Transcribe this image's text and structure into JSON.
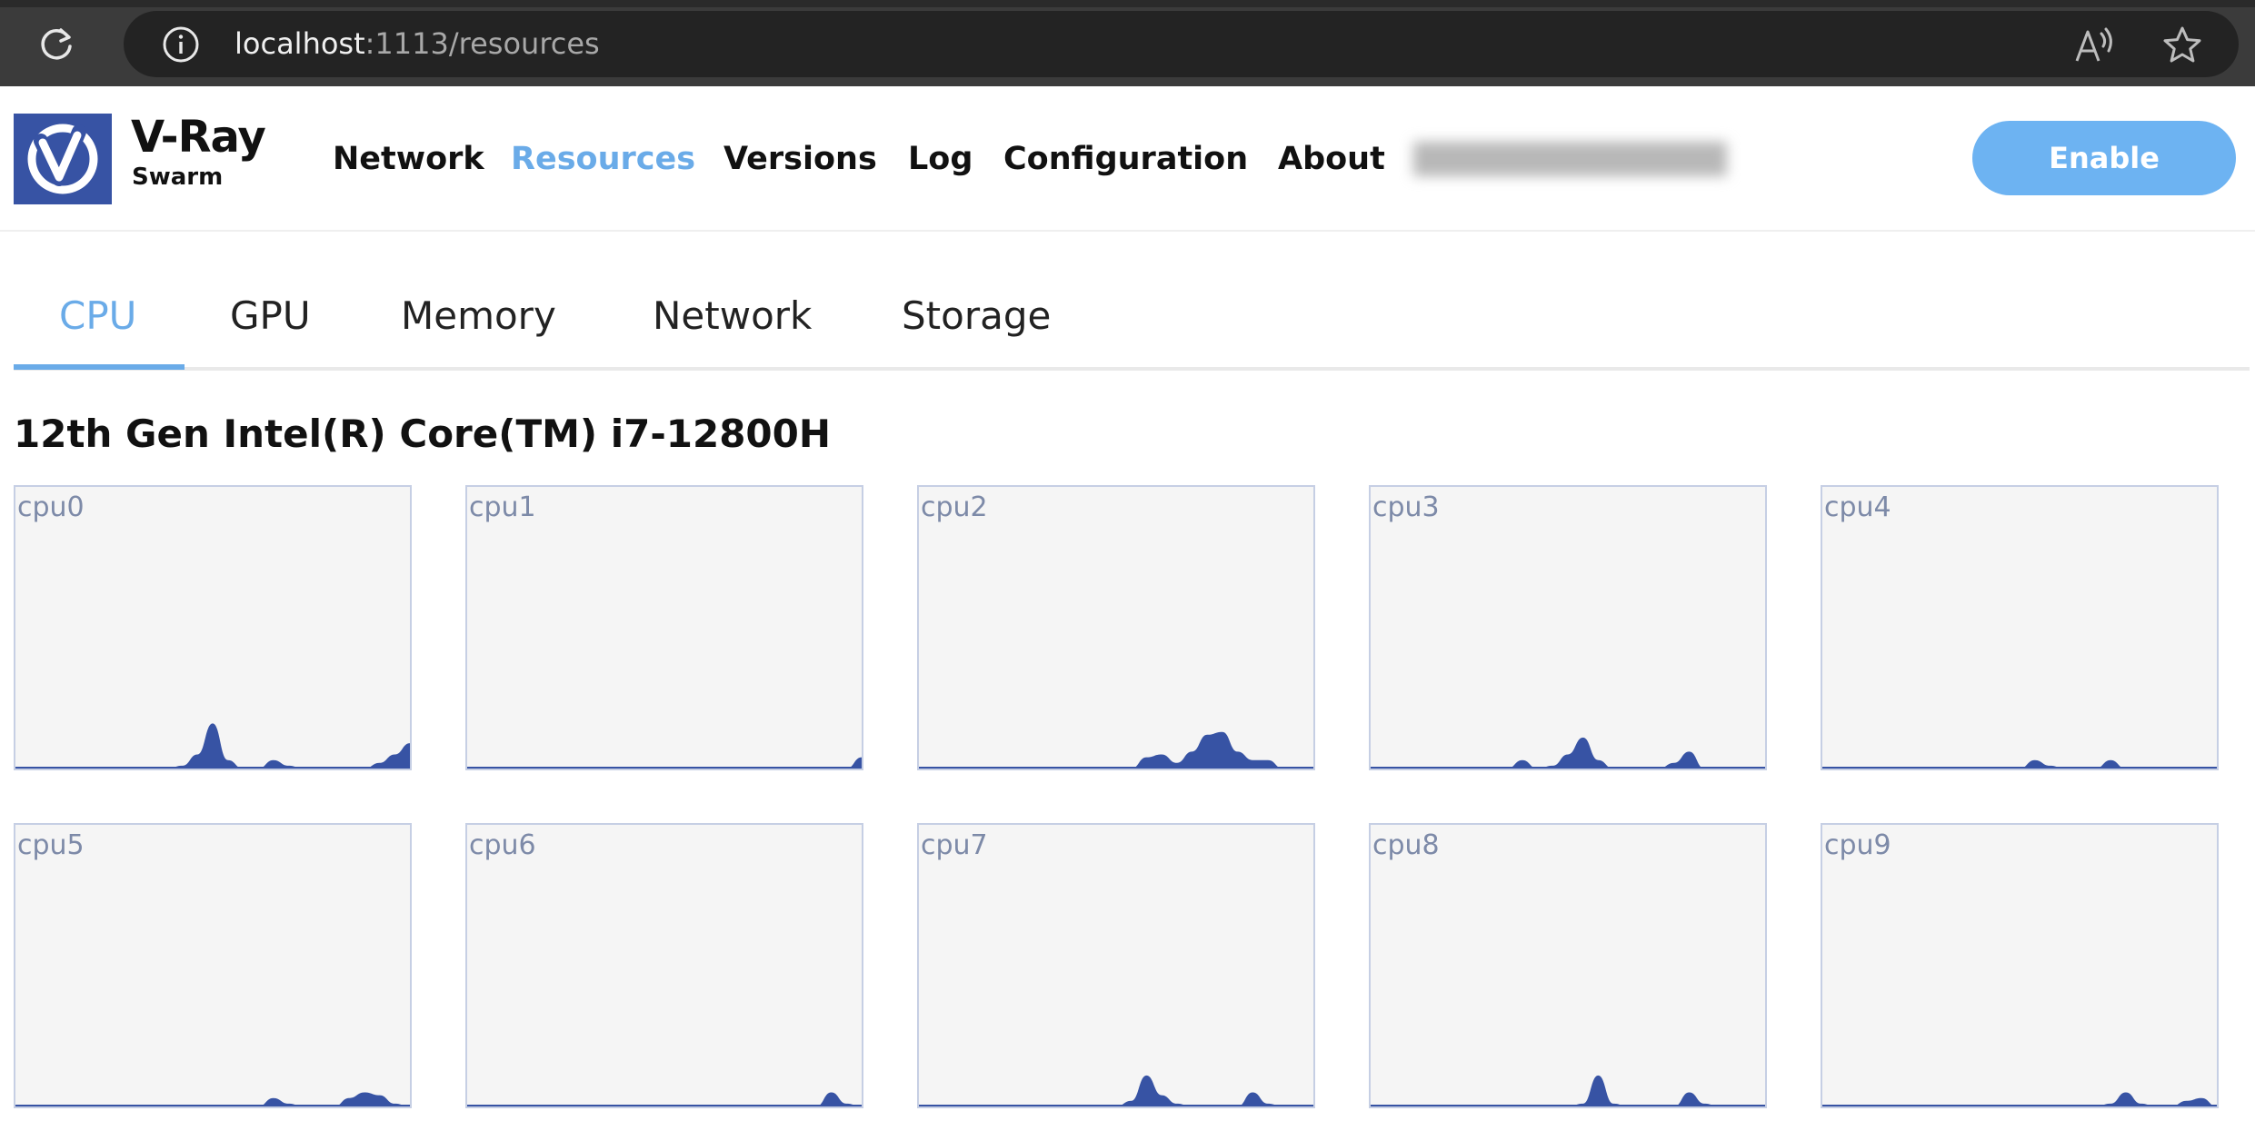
{
  "browser": {
    "url_host": "localhost",
    "url_rest": ":1113/resources",
    "icons": [
      "reload-icon",
      "info-icon",
      "read-aloud-icon",
      "favorite-star-icon"
    ]
  },
  "header": {
    "logo_title": "V-Ray",
    "logo_sub": "Swarm",
    "nav": [
      {
        "label": "Network",
        "active": false
      },
      {
        "label": "Resources",
        "active": true
      },
      {
        "label": "Versions",
        "active": false
      },
      {
        "label": "Log",
        "active": false
      },
      {
        "label": "Configuration",
        "active": false
      },
      {
        "label": "About",
        "active": false
      }
    ],
    "enable_label": "Enable",
    "accent_color": "#6db3f2",
    "brand_color": "#3753a4"
  },
  "tabs": [
    {
      "label": "CPU",
      "active": true
    },
    {
      "label": "GPU",
      "active": false
    },
    {
      "label": "Memory",
      "active": false
    },
    {
      "label": "Network",
      "active": false
    },
    {
      "label": "Storage",
      "active": false
    }
  ],
  "cpu": {
    "model": "12th Gen Intel(R) Core(TM) i7-12800H",
    "series_color": "#3753a4",
    "chart_data": [
      {
        "type": "area",
        "name": "cpu0",
        "ylim": [
          0,
          100
        ],
        "values": [
          0,
          0,
          0,
          0,
          0,
          0,
          0,
          0,
          0,
          0,
          0,
          1,
          5,
          16,
          3,
          0,
          0,
          3,
          1,
          0,
          0,
          0,
          0,
          0,
          2,
          5,
          9
        ]
      },
      {
        "type": "area",
        "name": "cpu1",
        "ylim": [
          0,
          100
        ],
        "values": [
          0,
          0,
          0,
          0,
          0,
          0,
          0,
          0,
          0,
          0,
          0,
          0,
          0,
          0,
          0,
          0,
          0,
          0,
          0,
          0,
          0,
          0,
          0,
          0,
          0,
          0,
          4
        ]
      },
      {
        "type": "area",
        "name": "cpu2",
        "ylim": [
          0,
          100
        ],
        "values": [
          0,
          0,
          0,
          0,
          0,
          0,
          0,
          0,
          0,
          0,
          0,
          0,
          0,
          0,
          0,
          4,
          5,
          2,
          6,
          12,
          13,
          6,
          3,
          3,
          0,
          0,
          0
        ]
      },
      {
        "type": "area",
        "name": "cpu3",
        "ylim": [
          0,
          100
        ],
        "values": [
          0,
          0,
          0,
          0,
          0,
          0,
          0,
          0,
          0,
          0,
          3,
          0,
          1,
          5,
          11,
          3,
          0,
          0,
          0,
          0,
          2,
          6,
          0,
          0,
          0,
          0,
          0
        ]
      },
      {
        "type": "area",
        "name": "cpu4",
        "ylim": [
          0,
          100
        ],
        "values": [
          0,
          0,
          0,
          0,
          0,
          0,
          0,
          0,
          0,
          0,
          0,
          0,
          0,
          0,
          3,
          1,
          0,
          0,
          0,
          3,
          0,
          0,
          0,
          0,
          0,
          0,
          0
        ]
      },
      {
        "type": "area",
        "name": "cpu5",
        "ylim": [
          0,
          100
        ],
        "values": [
          0,
          0,
          0,
          0,
          0,
          0,
          0,
          0,
          0,
          0,
          0,
          0,
          0,
          0,
          0,
          0,
          0,
          3,
          1,
          0,
          0,
          0,
          3,
          5,
          4,
          1,
          0
        ]
      },
      {
        "type": "area",
        "name": "cpu6",
        "ylim": [
          0,
          100
        ],
        "values": [
          0,
          0,
          0,
          0,
          0,
          0,
          0,
          0,
          0,
          0,
          0,
          0,
          0,
          0,
          0,
          0,
          0,
          0,
          0,
          0,
          0,
          0,
          0,
          0,
          5,
          1,
          0
        ]
      },
      {
        "type": "area",
        "name": "cpu7",
        "ylim": [
          0,
          100
        ],
        "values": [
          0,
          0,
          0,
          0,
          0,
          0,
          0,
          0,
          0,
          0,
          0,
          0,
          0,
          0,
          2,
          11,
          4,
          1,
          0,
          0,
          0,
          0,
          5,
          1,
          0,
          0,
          0
        ]
      },
      {
        "type": "area",
        "name": "cpu8",
        "ylim": [
          0,
          100
        ],
        "values": [
          0,
          0,
          0,
          0,
          0,
          0,
          0,
          0,
          0,
          0,
          0,
          0,
          0,
          0,
          1,
          11,
          1,
          0,
          0,
          0,
          0,
          5,
          1,
          0,
          0,
          0,
          0
        ]
      },
      {
        "type": "area",
        "name": "cpu9",
        "ylim": [
          0,
          100
        ],
        "values": [
          0,
          0,
          0,
          0,
          0,
          0,
          0,
          0,
          0,
          0,
          0,
          0,
          0,
          0,
          0,
          0,
          0,
          0,
          0,
          1,
          5,
          1,
          0,
          0,
          2,
          3,
          0
        ]
      }
    ]
  }
}
